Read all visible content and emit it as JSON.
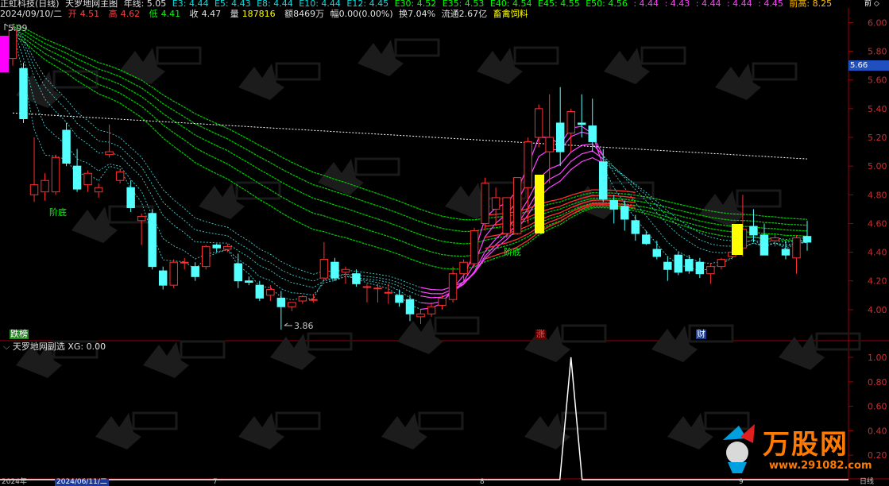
{
  "header": {
    "stock_name": "正虹科技(日线)",
    "indicator_name": "天罗地网主图",
    "line_label": "年线: 5.05",
    "ema_items": [
      "E3: 4.44",
      "E5: 4.43",
      "E8: 4.44",
      "E10: 4.44",
      "E12: 4.45",
      "E30: 4.52",
      "E35: 4.53",
      "E40: 4.54",
      "E45: 4.55",
      "E50: 4.56"
    ],
    "extra_items": [
      ": 4.44",
      ": 4.43",
      ": 4.44",
      ": 4.44",
      ": 4.45"
    ],
    "prev_high": "前高: 8.25",
    "date": "2024/09/10/二",
    "open_label": "开",
    "open": "4.51",
    "high_label": "高",
    "high": "4.62",
    "low_label": "低",
    "low": "4.41",
    "close_label": "收",
    "close": "4.47",
    "volume_label": "量",
    "volume": "187816",
    "amount": "额8469万",
    "change": "幅0.00(0.00%)",
    "turnover": "换7.04%",
    "float_cap": "流通2.67亿",
    "sector": "畜禽饲料"
  },
  "price_axis": [
    "6.00",
    "5.80",
    "5.60",
    "5.40",
    "5.20",
    "5.00",
    "4.80",
    "4.60",
    "4.40",
    "4.20",
    "4.00"
  ],
  "current_price": "5.66",
  "markers": {
    "high_marker": "5.99",
    "low_marker": "3.86",
    "stage_bottom_1": "阶底",
    "stage_bottom_2": "阶底",
    "top_list": "跌榜",
    "limit_up": "涨",
    "finance": "财"
  },
  "sub_panel": {
    "title": "天罗地网副选",
    "xg_label": "XG: 0.00",
    "axis": [
      "1.00",
      "0.80",
      "0.60",
      "0.40",
      "0.20"
    ]
  },
  "bottom_axis": {
    "year": "2024年",
    "cursor_date": "2024/06/11/二",
    "months": [
      "7",
      "8",
      "9"
    ],
    "period": "日线"
  },
  "logo": {
    "text": "万股网",
    "url": "www.291082.com"
  },
  "chart_data": {
    "type": "candlestick",
    "ylim": [
      3.8,
      6.08
    ],
    "candles": [
      {
        "o": 5.75,
        "h": 5.99,
        "l": 5.7,
        "c": 5.95
      },
      {
        "o": 5.68,
        "h": 5.72,
        "l": 5.3,
        "c": 5.33
      },
      {
        "o": 4.8,
        "h": 5.2,
        "l": 4.75,
        "c": 4.87
      },
      {
        "o": 4.82,
        "h": 4.95,
        "l": 4.76,
        "c": 4.9
      },
      {
        "o": 4.82,
        "h": 5.08,
        "l": 4.8,
        "c": 5.06
      },
      {
        "o": 5.25,
        "h": 5.3,
        "l": 5.0,
        "c": 5.02
      },
      {
        "o": 5.0,
        "h": 5.12,
        "l": 4.82,
        "c": 4.84
      },
      {
        "o": 4.87,
        "h": 4.97,
        "l": 4.82,
        "c": 4.95
      },
      {
        "o": 4.82,
        "h": 4.88,
        "l": 4.78,
        "c": 4.85
      },
      {
        "o": 5.08,
        "h": 5.29,
        "l": 5.06,
        "c": 5.1
      },
      {
        "o": 4.9,
        "h": 4.98,
        "l": 4.88,
        "c": 4.96
      },
      {
        "o": 4.85,
        "h": 4.9,
        "l": 4.68,
        "c": 4.71
      },
      {
        "o": 4.62,
        "h": 4.67,
        "l": 4.45,
        "c": 4.65
      },
      {
        "o": 4.67,
        "h": 4.7,
        "l": 4.28,
        "c": 4.3
      },
      {
        "o": 4.27,
        "h": 4.3,
        "l": 4.14,
        "c": 4.17
      },
      {
        "o": 4.17,
        "h": 4.35,
        "l": 4.15,
        "c": 4.33
      },
      {
        "o": 4.33,
        "h": 4.36,
        "l": 4.28,
        "c": 4.33
      },
      {
        "o": 4.3,
        "h": 4.33,
        "l": 4.2,
        "c": 4.23
      },
      {
        "o": 4.3,
        "h": 4.45,
        "l": 4.28,
        "c": 4.44
      },
      {
        "o": 4.45,
        "h": 4.46,
        "l": 4.4,
        "c": 4.43
      },
      {
        "o": 4.42,
        "h": 4.46,
        "l": 4.4,
        "c": 4.44
      },
      {
        "o": 4.32,
        "h": 4.39,
        "l": 4.15,
        "c": 4.2
      },
      {
        "o": 4.2,
        "h": 4.23,
        "l": 4.17,
        "c": 4.19
      },
      {
        "o": 4.17,
        "h": 4.2,
        "l": 4.06,
        "c": 4.08
      },
      {
        "o": 4.1,
        "h": 4.17,
        "l": 4.06,
        "c": 4.14
      },
      {
        "o": 4.08,
        "h": 4.13,
        "l": 3.86,
        "c": 4.02
      },
      {
        "o": 4.02,
        "h": 4.05,
        "l": 3.99,
        "c": 4.05
      },
      {
        "o": 4.06,
        "h": 4.1,
        "l": 4.04,
        "c": 4.09
      },
      {
        "o": 4.07,
        "h": 4.11,
        "l": 4.05,
        "c": 4.07
      },
      {
        "o": 4.22,
        "h": 4.47,
        "l": 4.2,
        "c": 4.35
      },
      {
        "o": 4.33,
        "h": 4.36,
        "l": 4.2,
        "c": 4.22
      },
      {
        "o": 4.26,
        "h": 4.3,
        "l": 4.18,
        "c": 4.28
      },
      {
        "o": 4.25,
        "h": 4.28,
        "l": 4.16,
        "c": 4.18
      },
      {
        "o": 4.16,
        "h": 4.18,
        "l": 4.05,
        "c": 4.16
      },
      {
        "o": 4.15,
        "h": 4.18,
        "l": 4.05,
        "c": 4.15
      },
      {
        "o": 4.12,
        "h": 4.18,
        "l": 4.04,
        "c": 4.12
      },
      {
        "o": 4.1,
        "h": 4.14,
        "l": 4.02,
        "c": 4.05
      },
      {
        "o": 4.07,
        "h": 4.1,
        "l": 3.92,
        "c": 3.97
      },
      {
        "o": 3.95,
        "h": 4.0,
        "l": 3.9,
        "c": 3.97
      },
      {
        "o": 3.97,
        "h": 4.05,
        "l": 3.95,
        "c": 4.02
      },
      {
        "o": 4.03,
        "h": 4.1,
        "l": 4.0,
        "c": 4.08
      },
      {
        "o": 4.07,
        "h": 4.3,
        "l": 4.05,
        "c": 4.25
      },
      {
        "o": 4.25,
        "h": 4.35,
        "l": 4.2,
        "c": 4.33
      },
      {
        "o": 4.32,
        "h": 4.57,
        "l": 4.3,
        "c": 4.55
      },
      {
        "o": 4.6,
        "h": 4.92,
        "l": 4.55,
        "c": 4.88
      },
      {
        "o": 4.7,
        "h": 4.85,
        "l": 4.58,
        "c": 4.78
      },
      {
        "o": 4.53,
        "h": 4.75,
        "l": 4.5,
        "c": 4.78
      },
      {
        "o": 4.53,
        "h": 4.92,
        "l": 4.52,
        "c": 4.92
      },
      {
        "o": 4.85,
        "h": 5.2,
        "l": 4.6,
        "c": 5.17
      },
      {
        "o": 5.2,
        "h": 5.43,
        "l": 5.13,
        "c": 5.4
      },
      {
        "o": 5.1,
        "h": 5.5,
        "l": 4.88,
        "c": 5.2
      },
      {
        "o": 5.3,
        "h": 5.55,
        "l": 5.0,
        "c": 5.1
      },
      {
        "o": 5.23,
        "h": 5.4,
        "l": 5.1,
        "c": 5.38
      },
      {
        "o": 5.3,
        "h": 5.5,
        "l": 5.2,
        "c": 5.29
      },
      {
        "o": 5.28,
        "h": 5.47,
        "l": 5.1,
        "c": 5.17
      },
      {
        "o": 5.03,
        "h": 5.12,
        "l": 4.75,
        "c": 4.77
      },
      {
        "o": 4.76,
        "h": 4.8,
        "l": 4.6,
        "c": 4.7
      },
      {
        "o": 4.72,
        "h": 4.76,
        "l": 4.55,
        "c": 4.63
      },
      {
        "o": 4.62,
        "h": 4.66,
        "l": 4.48,
        "c": 4.53
      },
      {
        "o": 4.52,
        "h": 4.55,
        "l": 4.45,
        "c": 4.46
      },
      {
        "o": 4.42,
        "h": 4.48,
        "l": 4.35,
        "c": 4.37
      },
      {
        "o": 4.33,
        "h": 4.37,
        "l": 4.2,
        "c": 4.28
      },
      {
        "o": 4.38,
        "h": 4.4,
        "l": 4.24,
        "c": 4.26
      },
      {
        "o": 4.35,
        "h": 4.38,
        "l": 4.25,
        "c": 4.27
      },
      {
        "o": 4.33,
        "h": 4.36,
        "l": 4.22,
        "c": 4.25
      },
      {
        "o": 4.25,
        "h": 4.32,
        "l": 4.18,
        "c": 4.3
      },
      {
        "o": 4.3,
        "h": 4.36,
        "l": 4.28,
        "c": 4.35
      },
      {
        "o": 4.37,
        "h": 4.42,
        "l": 4.35,
        "c": 4.4
      },
      {
        "o": 4.43,
        "h": 4.8,
        "l": 4.37,
        "c": 4.56
      },
      {
        "o": 4.58,
        "h": 4.7,
        "l": 4.47,
        "c": 4.52
      },
      {
        "o": 4.52,
        "h": 4.6,
        "l": 4.38,
        "c": 4.38
      },
      {
        "o": 4.48,
        "h": 4.52,
        "l": 4.44,
        "c": 4.5
      },
      {
        "o": 4.42,
        "h": 4.48,
        "l": 4.35,
        "c": 4.38
      },
      {
        "o": 4.36,
        "h": 4.52,
        "l": 4.25,
        "c": 4.5
      },
      {
        "o": 4.51,
        "h": 4.62,
        "l": 4.41,
        "c": 4.47
      }
    ],
    "annual_line": {
      "start": 5.37,
      "end": 5.05
    },
    "signal_x_index": 52
  }
}
